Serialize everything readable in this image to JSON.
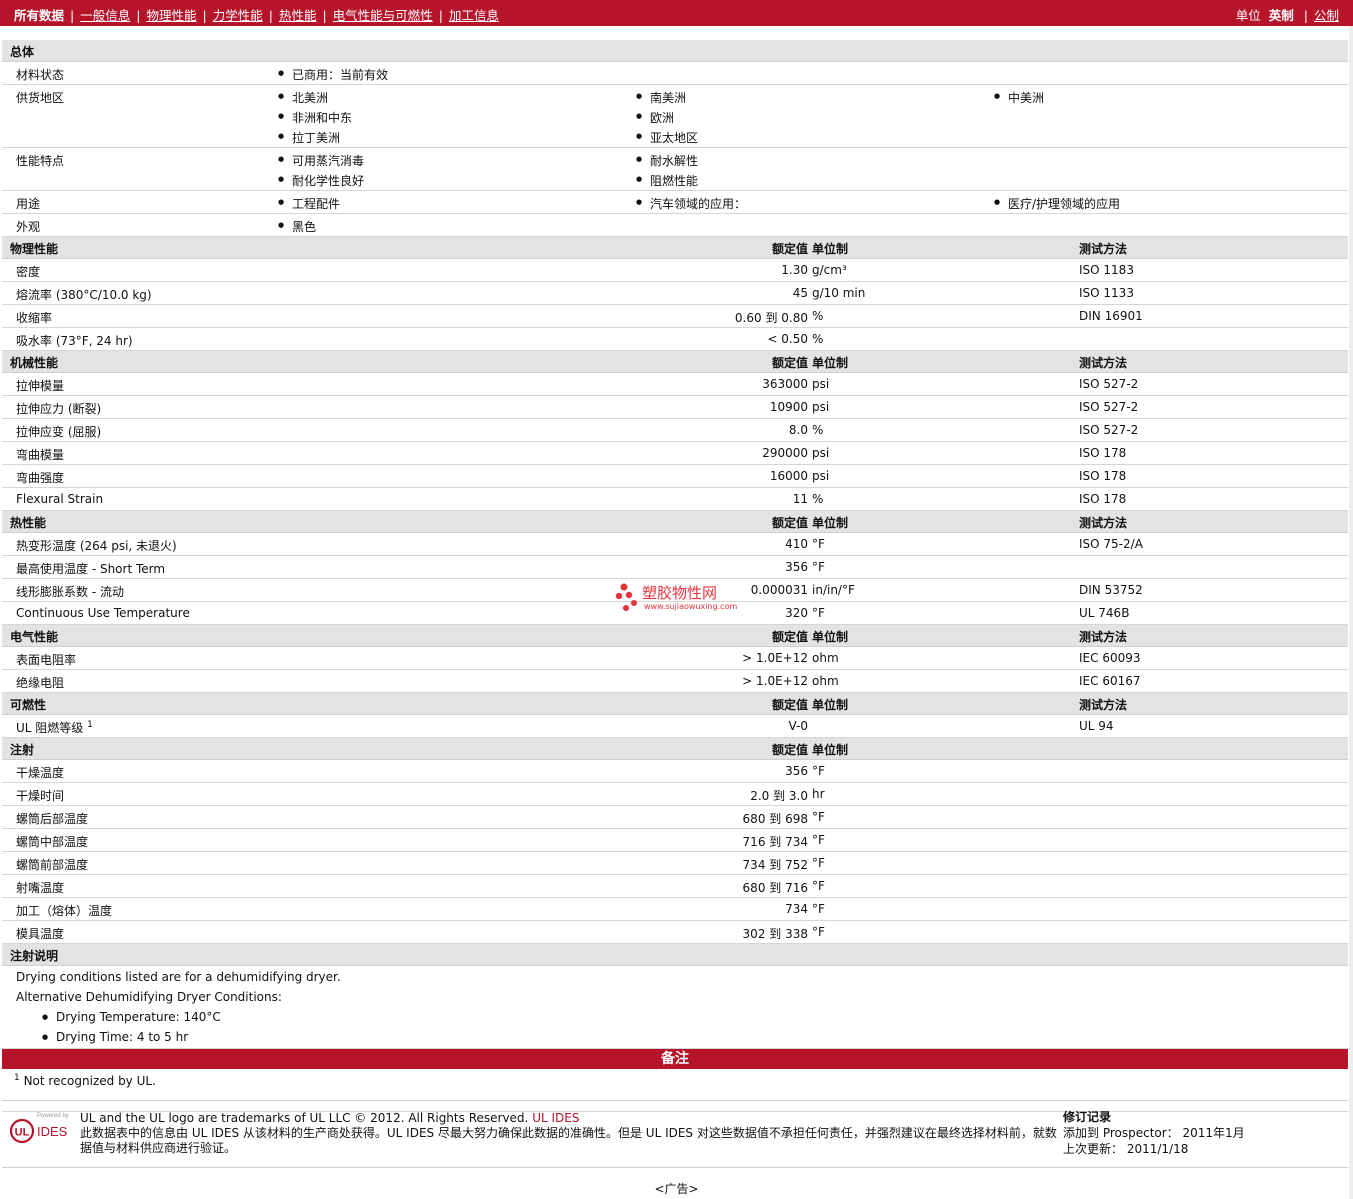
{
  "nav": {
    "all": "所有数据",
    "links": [
      "一般信息",
      "物理性能",
      "力学性能",
      "热性能",
      "电气性能与可燃性",
      "加工信息"
    ],
    "units_label": "单位",
    "unit_selected": "英制",
    "unit_other": "公制"
  },
  "general": {
    "title": "总体",
    "material_status": {
      "label": "材料状态",
      "items": [
        "已商用：当前有效"
      ]
    },
    "region": {
      "label": "供货地区",
      "items": [
        "北美洲",
        "南美洲",
        "中美洲",
        "非洲和中东",
        "欧洲",
        "拉丁美洲",
        "亚太地区"
      ]
    },
    "features": {
      "label": "性能特点",
      "items": [
        "可用蒸汽消毒",
        "耐水解性",
        "耐化学性良好",
        "阻燃性能"
      ]
    },
    "uses": {
      "label": "用途",
      "items": [
        "工程配件",
        "汽车领域的应用：",
        "医疗/护理领域的应用"
      ]
    },
    "appearance": {
      "label": "外观",
      "items": [
        "黑色"
      ]
    }
  },
  "headers": {
    "value": "额定值",
    "unit": "单位制",
    "method": "测试方法"
  },
  "physical": {
    "title": "物理性能",
    "rows": [
      {
        "label": "密度",
        "value": "1.30",
        "unit": "g/cm³",
        "method": "ISO 1183"
      },
      {
        "label": "熔流率 (380°C/10.0 kg)",
        "value": "45",
        "unit": "g/10 min",
        "method": "ISO 1133"
      },
      {
        "label": "收缩率",
        "value": "0.60 到  0.80",
        "unit": "%",
        "method": "DIN 16901"
      },
      {
        "label": "吸水率 (73°F, 24 hr)",
        "value": "< 0.50",
        "unit": "%",
        "method": ""
      }
    ]
  },
  "mechanical": {
    "title": "机械性能",
    "rows": [
      {
        "label": "拉伸模量",
        "value": "363000",
        "unit": "psi",
        "method": "ISO 527-2"
      },
      {
        "label": "拉伸应力 (断裂)",
        "value": "10900",
        "unit": "psi",
        "method": "ISO 527-2"
      },
      {
        "label": "拉伸应变 (屈服)",
        "value": "8.0",
        "unit": "%",
        "method": "ISO 527-2"
      },
      {
        "label": "弯曲模量",
        "value": "290000",
        "unit": "psi",
        "method": "ISO 178"
      },
      {
        "label": "弯曲强度",
        "value": "16000",
        "unit": "psi",
        "method": "ISO 178"
      },
      {
        "label": "Flexural Strain",
        "value": "11",
        "unit": "%",
        "method": "ISO 178"
      }
    ]
  },
  "thermal": {
    "title": "热性能",
    "rows": [
      {
        "label": "热变形温度 (264 psi, 未退火)",
        "value": "410",
        "unit": "°F",
        "method": "ISO 75-2/A"
      },
      {
        "label": "最高使用温度  - Short Term",
        "value": "356",
        "unit": "°F",
        "method": ""
      },
      {
        "label": "线形膨胀系数  - 流动",
        "value": "0.000031",
        "unit": "in/in/°F",
        "method": "DIN 53752"
      },
      {
        "label": "Continuous Use Temperature",
        "value": "320",
        "unit": "°F",
        "method": "UL 746B"
      }
    ]
  },
  "electrical": {
    "title": "电气性能",
    "rows": [
      {
        "label": "表面电阻率",
        "value": "> 1.0E+12",
        "unit": "ohm",
        "method": "IEC 60093"
      },
      {
        "label": "绝缘电阻",
        "value": "> 1.0E+12",
        "unit": "ohm",
        "method": "IEC 60167"
      }
    ]
  },
  "flammability": {
    "title": "可燃性",
    "rows": [
      {
        "label": "UL 阻燃等级",
        "sup": "1",
        "value": "V-0",
        "unit": "",
        "method": "UL 94"
      }
    ]
  },
  "injection": {
    "title": "注射",
    "rows": [
      {
        "label": "干燥温度",
        "value": "356",
        "unit": "°F"
      },
      {
        "label": "干燥时间",
        "value": "2.0 到  3.0",
        "unit": "hr"
      },
      {
        "label": "螺筒后部温度",
        "value": "680 到  698",
        "unit": "°F"
      },
      {
        "label": "螺筒中部温度",
        "value": "716 到  734",
        "unit": "°F"
      },
      {
        "label": "螺筒前部温度",
        "value": "734 到  752",
        "unit": "°F"
      },
      {
        "label": "射嘴温度",
        "value": "680 到  716",
        "unit": "°F"
      },
      {
        "label": "加工（熔体）温度",
        "value": "734",
        "unit": "°F"
      },
      {
        "label": "模具温度",
        "value": "302 到  338",
        "unit": "°F"
      }
    ]
  },
  "injection_notes": {
    "title": "注射说明",
    "line1": "Drying conditions listed are for a dehumidifying dryer.",
    "line2": "Alternative Dehumidifying Dryer Conditions:",
    "bullets": [
      "Drying Temperature: 140°C",
      "Drying Time: 4 to 5 hr"
    ]
  },
  "remarks": {
    "title": "备注",
    "footnote_num": "1",
    "footnote": "Not recognized by UL."
  },
  "footer": {
    "logo_powered": "Powered by",
    "logo_ul": "UL",
    "logo_ides": "IDES",
    "line1": "UL and the UL logo are trademarks of UL LLC © 2012. All Rights Reserved.",
    "line1_link": "UL IDES",
    "line2": "此数据表中的信息由  UL IDES 从该材料的生产商处获得。UL IDES 尽最大努力确保此数据的准确性。但是  UL IDES 对这些数据值不承担任何责任，并强烈建议在最终选择材料前，就数据值与材料供应商进行验证。",
    "rev_title": "修订记录",
    "rev_added": "添加到  Prospector：   2011年1月",
    "rev_updated": "上次更新：   2011/1/18"
  },
  "ad": "<广告>",
  "watermark": {
    "name": "塑胶物性网",
    "url": "www.sujiaowuxing.com"
  }
}
